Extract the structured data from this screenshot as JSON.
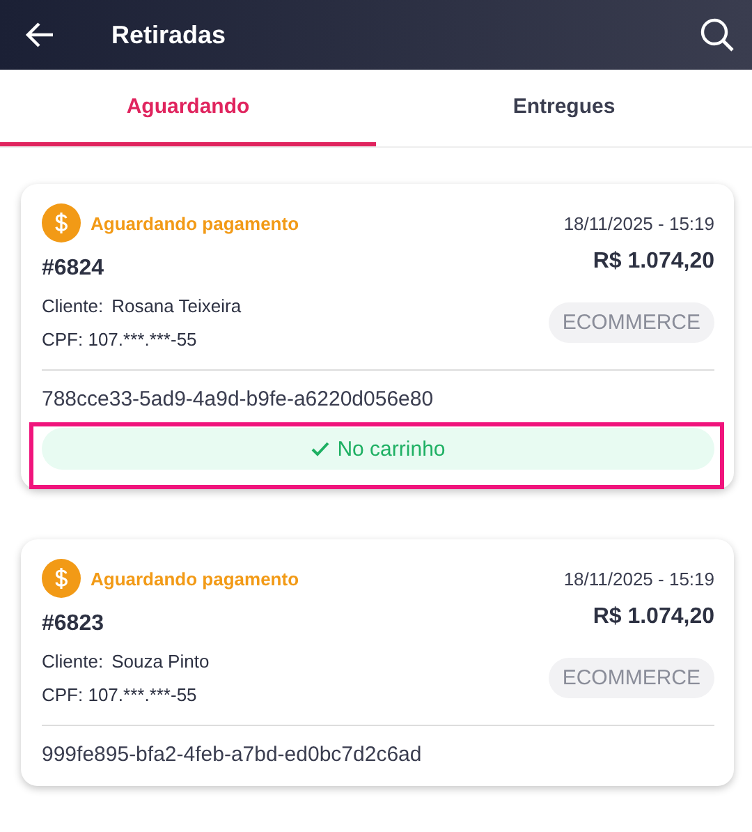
{
  "header": {
    "title": "Retiradas"
  },
  "tabs": [
    {
      "label": "Aguardando",
      "selected": true
    },
    {
      "label": "Entregues",
      "selected": false
    }
  ],
  "orders": [
    {
      "status": "Aguardando pagamento",
      "date": "18/11/2025 - 15:19",
      "number": "#6824",
      "total": "R$ 1.074,20",
      "client_label": "Cliente:",
      "client": "Rosana Teixeira",
      "cpf": "CPF: 107.***.***-55",
      "channel": "ECOMMERCE",
      "code": "788cce33-5ad9-4a9d-b9fe-a6220d056e80",
      "cart": {
        "label": "No carrinho",
        "highlighted": true
      }
    },
    {
      "status": "Aguardando pagamento",
      "date": "18/11/2025 - 15:19",
      "number": "#6823",
      "total": "R$ 1.074,20",
      "client_label": "Cliente:",
      "client": "Souza Pinto",
      "cpf": "CPF: 107.***.***-55",
      "channel": "ECOMMERCE",
      "code": "999fe895-bfa2-4feb-a7bd-ed0bc7d2c6ad"
    }
  ]
}
